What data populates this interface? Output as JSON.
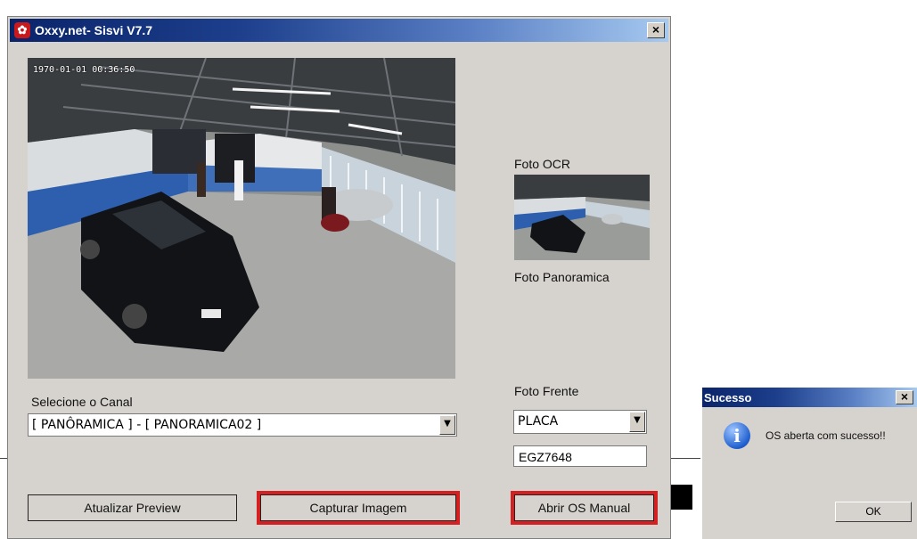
{
  "window": {
    "title": "Oxxy.net- Sisvi V7.7",
    "close_glyph": "×",
    "app_icon": "oxxy-logo-icon"
  },
  "preview": {
    "timestamp": "1970-01-01 00:36:50"
  },
  "right_panel": {
    "foto_ocr_label": "Foto OCR",
    "foto_panoramica_label": "Foto Panoramica",
    "foto_frente_label": "Foto Frente",
    "placa_combo_value": "PLACA",
    "plate_value": "EGZ7648"
  },
  "channel": {
    "label": "Selecione o Canal",
    "selected": "[ PANÔRAMICA ] - [ PANORAMICA02 ]"
  },
  "buttons": {
    "atualizar": "Atualizar Preview",
    "capturar": "Capturar Imagem",
    "abrir_os": "Abrir OS Manual"
  },
  "dialog": {
    "title": "Sucesso",
    "message": "OS aberta com sucesso!!",
    "ok": "OK",
    "icon": "info-icon"
  },
  "colors": {
    "highlight": "#d42020",
    "titlebar_dark": "#0a246a",
    "titlebar_light": "#a6caf0"
  }
}
